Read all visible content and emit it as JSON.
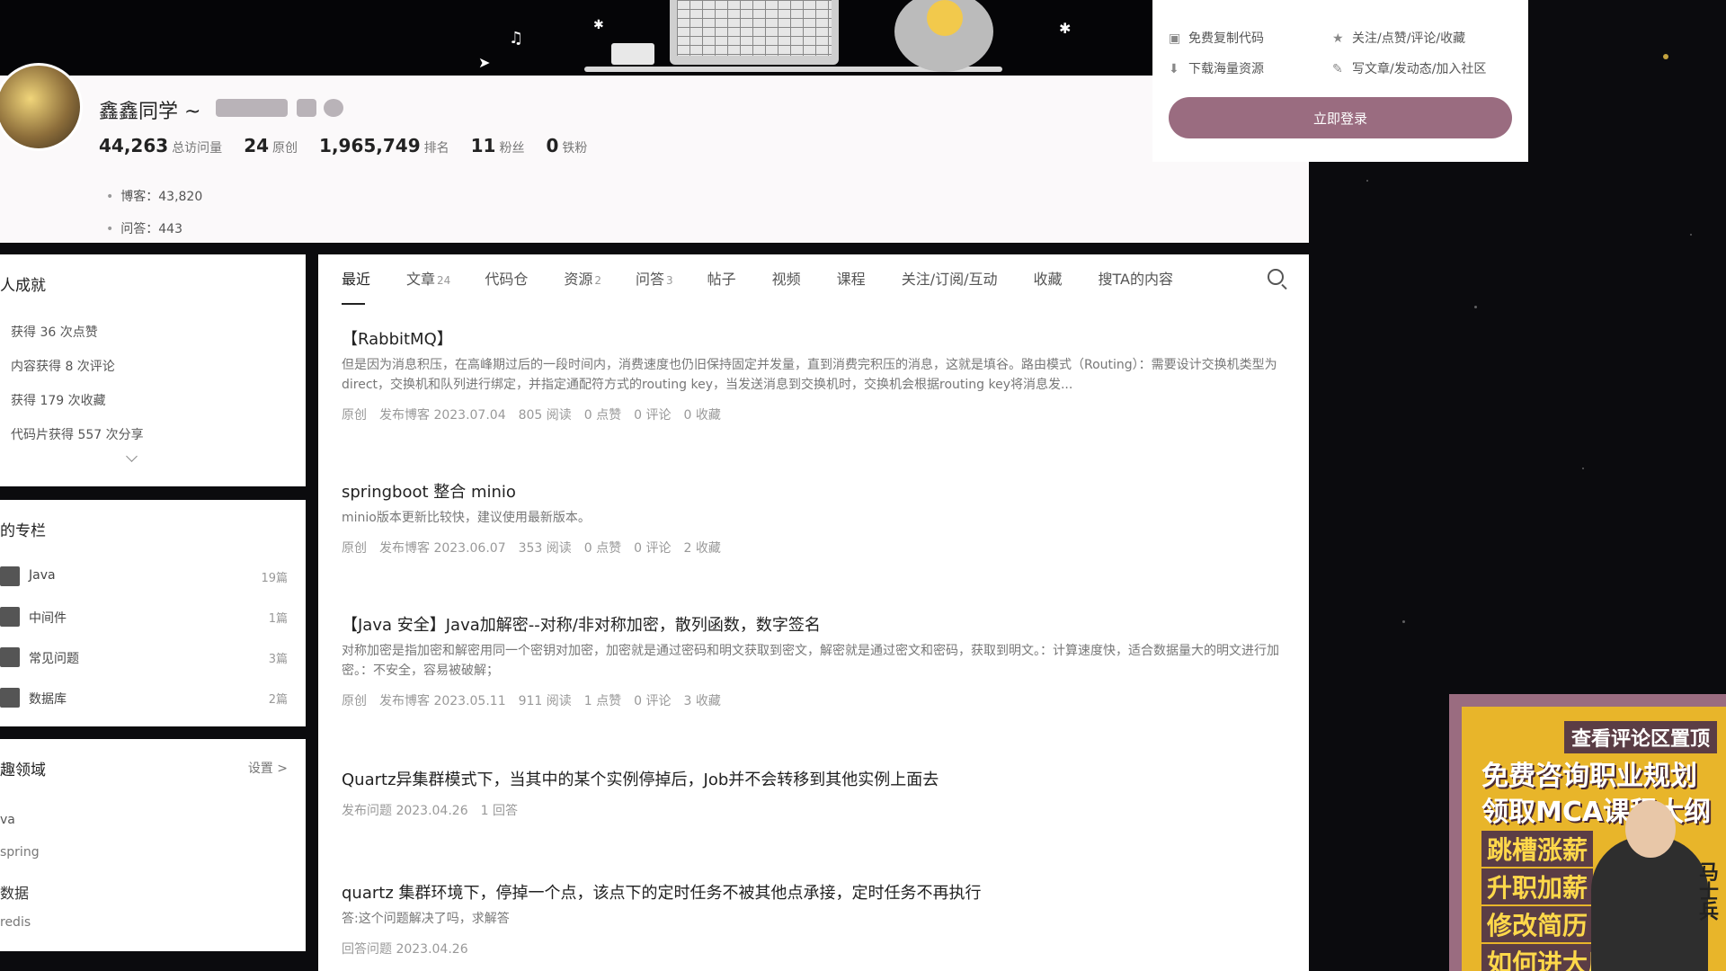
{
  "profile": {
    "username": "鑫鑫同学 ~",
    "stats": [
      {
        "num": "44,263",
        "label": "总访问量"
      },
      {
        "num": "24",
        "label": "原创"
      },
      {
        "num": "1,965,749",
        "label": "排名"
      },
      {
        "num": "11",
        "label": "粉丝"
      },
      {
        "num": "0",
        "label": "铁粉"
      }
    ],
    "blog_line": "博客：43,820",
    "qa_line": "问答：443"
  },
  "login": {
    "perks": [
      "免费复制代码",
      "关注/点赞/评论/收藏",
      "下载海量资源",
      "写文章/发动态/加入社区"
    ],
    "button": "立即登录"
  },
  "sidebar": {
    "achievements_title": "人成就",
    "achievements": [
      "获得 36 次点赞",
      "内容获得 8 次评论",
      "获得 179 次收藏",
      "代码片获得 557 次分享"
    ],
    "columns_title": "的专栏",
    "columns": [
      {
        "name": "Java",
        "count": "19篇"
      },
      {
        "name": "中间件",
        "count": "1篇"
      },
      {
        "name": "常见问题",
        "count": "3篇"
      },
      {
        "name": "数据库",
        "count": "2篇"
      }
    ],
    "fields_title": "趣领域",
    "fields_settings": "设置 >",
    "fields": [
      "va",
      "spring",
      "数据",
      "redis"
    ]
  },
  "tabs": [
    {
      "label": "最近",
      "count": ""
    },
    {
      "label": "文章",
      "count": "24"
    },
    {
      "label": "代码仓",
      "count": ""
    },
    {
      "label": "资源",
      "count": "2"
    },
    {
      "label": "问答",
      "count": "3"
    },
    {
      "label": "帖子",
      "count": ""
    },
    {
      "label": "视频",
      "count": ""
    },
    {
      "label": "课程",
      "count": ""
    },
    {
      "label": "关注/订阅/互动",
      "count": ""
    },
    {
      "label": "收藏",
      "count": ""
    },
    {
      "label": "搜TA的内容",
      "count": ""
    }
  ],
  "items": [
    {
      "title": "【RabbitMQ】",
      "desc": "但是因为消息积压，在高峰期过后的一段时间内，消费速度也仍旧保持固定并发量，直到消费完积压的消息，这就是填谷。路由模式（Routing）：需要设计交换机类型为 direct，交换机和队列进行绑定，并指定通配符方式的routing key，当发送消息到交换机时，交换机会根据routing key将消息发...",
      "meta": [
        "原创",
        "发布博客 2023.07.04",
        "805 阅读",
        "0 点赞",
        "0 评论",
        "0 收藏"
      ]
    },
    {
      "title": "springboot 整合 minio",
      "desc": "minio版本更新比较快，建议使用最新版本。",
      "meta": [
        "原创",
        "发布博客 2023.06.07",
        "353 阅读",
        "0 点赞",
        "0 评论",
        "2 收藏"
      ]
    },
    {
      "title": "【Java 安全】Java加解密--对称/非对称加密，散列函数，数字签名",
      "desc": "对称加密是指加密和解密用同一个密钥对加密，加密就是通过密码和明文获取到密文，解密就是通过密文和密码，获取到明文。：计算速度快，适合数据量大的明文进行加密。：不安全，容易被破解；",
      "meta": [
        "原创",
        "发布博客 2023.05.11",
        "911 阅读",
        "1 点赞",
        "0 评论",
        "3 收藏"
      ]
    },
    {
      "title": "Quartz异集群模式下，当其中的某个实例停掉后，Job并不会转移到其他实例上面去",
      "desc": "",
      "meta": [
        "发布问题 2023.04.26",
        "1 回答"
      ]
    },
    {
      "title": "quartz 集群环境下，停掉一个点，该点下的定时任务不被其他点承接，定时任务不再执行",
      "desc": "答:这个问题解决了吗，求解答",
      "meta": [
        "回答问题 2023.04.26"
      ]
    }
  ],
  "ad": {
    "top": "查看评论区置顶",
    "line1": "免费咨询职业规划",
    "line2": "领取MCA课程大纲",
    "chips": [
      "跳槽涨薪",
      "升职加薪",
      "修改简历",
      "如何进大厂"
    ],
    "name": "马士兵"
  },
  "colors": {
    "accent": "#9a6c80",
    "ad_bg": "#e8b52a"
  }
}
